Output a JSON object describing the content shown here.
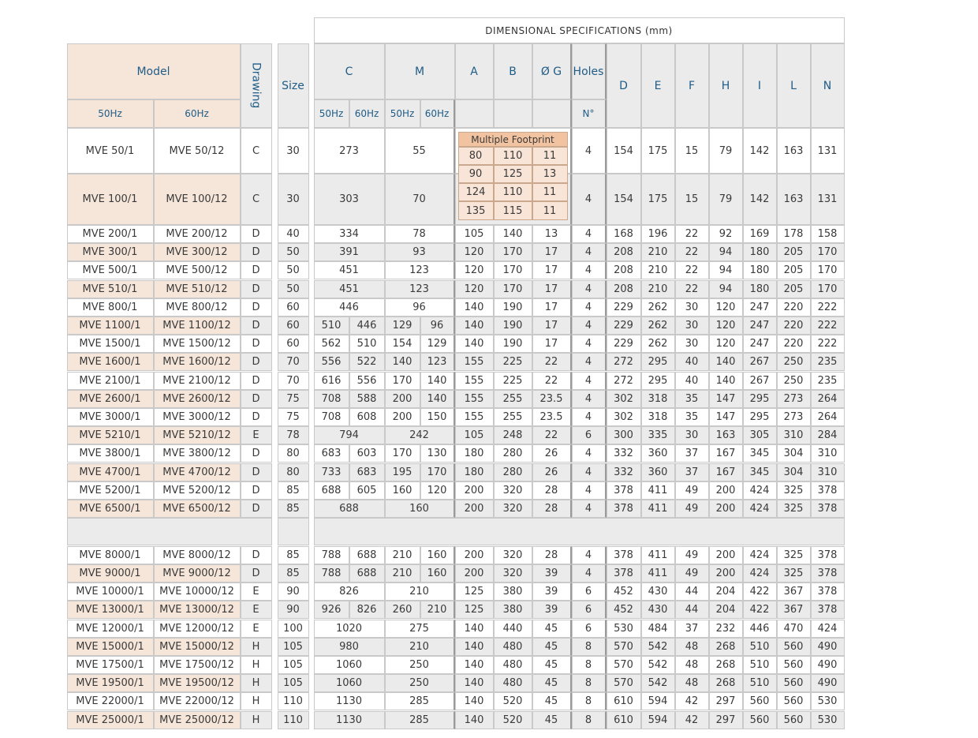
{
  "header": {
    "title": "DIMENSIONAL SPECIFICATIONS (mm)",
    "model": "Model",
    "hz50": "50Hz",
    "hz60": "60Hz",
    "drawing": "Drawing",
    "size": "Size",
    "C": "C",
    "M": "M",
    "A": "A",
    "B": "B",
    "G": "Ø G",
    "holes": "Holes",
    "no": "N°",
    "D": "D",
    "E": "E",
    "F": "F",
    "H": "H",
    "I": "I",
    "L": "L",
    "N": "N"
  },
  "footprint": {
    "title": "Multiple Footprint",
    "rows": [
      [
        "80",
        "110",
        "11"
      ],
      [
        "90",
        "125",
        "13"
      ],
      [
        "124",
        "110",
        "11"
      ],
      [
        "135",
        "115",
        "11"
      ]
    ]
  },
  "rows": [
    {
      "m50": "MVE 50/1",
      "m60": "MVE 50/12",
      "dr": "C",
      "size": "30",
      "c": [
        "273"
      ],
      "m": [
        "55"
      ],
      "abg": null,
      "holes": "4",
      "dims": [
        "154",
        "175",
        "15",
        "79",
        "142",
        "163",
        "131"
      ]
    },
    {
      "m50": "MVE 100/1",
      "m60": "MVE 100/12",
      "dr": "C",
      "size": "30",
      "c": [
        "303"
      ],
      "m": [
        "70"
      ],
      "abg": null,
      "holes": "4",
      "dims": [
        "154",
        "175",
        "15",
        "79",
        "142",
        "163",
        "131"
      ]
    },
    {
      "m50": "MVE 200/1",
      "m60": "MVE 200/12",
      "dr": "D",
      "size": "40",
      "c": [
        "334"
      ],
      "m": [
        "78"
      ],
      "abg": [
        "105",
        "140",
        "13"
      ],
      "holes": "4",
      "dims": [
        "168",
        "196",
        "22",
        "92",
        "169",
        "178",
        "158"
      ]
    },
    {
      "m50": "MVE 300/1",
      "m60": "MVE 300/12",
      "dr": "D",
      "size": "50",
      "c": [
        "391"
      ],
      "m": [
        "93"
      ],
      "abg": [
        "120",
        "170",
        "17"
      ],
      "holes": "4",
      "dims": [
        "208",
        "210",
        "22",
        "94",
        "180",
        "205",
        "170"
      ]
    },
    {
      "m50": "MVE 500/1",
      "m60": "MVE 500/12",
      "dr": "D",
      "size": "50",
      "c": [
        "451"
      ],
      "m": [
        "123"
      ],
      "abg": [
        "120",
        "170",
        "17"
      ],
      "holes": "4",
      "dims": [
        "208",
        "210",
        "22",
        "94",
        "180",
        "205",
        "170"
      ]
    },
    {
      "m50": "MVE 510/1",
      "m60": "MVE 510/12",
      "dr": "D",
      "size": "50",
      "c": [
        "451"
      ],
      "m": [
        "123"
      ],
      "abg": [
        "120",
        "170",
        "17"
      ],
      "holes": "4",
      "dims": [
        "208",
        "210",
        "22",
        "94",
        "180",
        "205",
        "170"
      ]
    },
    {
      "m50": "MVE 800/1",
      "m60": "MVE 800/12",
      "dr": "D",
      "size": "60",
      "c": [
        "446"
      ],
      "m": [
        "96"
      ],
      "abg": [
        "140",
        "190",
        "17"
      ],
      "holes": "4",
      "dims": [
        "229",
        "262",
        "30",
        "120",
        "247",
        "220",
        "222"
      ]
    },
    {
      "m50": "MVE 1100/1",
      "m60": "MVE 1100/12",
      "dr": "D",
      "size": "60",
      "c": [
        "510",
        "446"
      ],
      "m": [
        "129",
        "96"
      ],
      "abg": [
        "140",
        "190",
        "17"
      ],
      "holes": "4",
      "dims": [
        "229",
        "262",
        "30",
        "120",
        "247",
        "220",
        "222"
      ]
    },
    {
      "m50": "MVE 1500/1",
      "m60": "MVE 1500/12",
      "dr": "D",
      "size": "60",
      "c": [
        "562",
        "510"
      ],
      "m": [
        "154",
        "129"
      ],
      "abg": [
        "140",
        "190",
        "17"
      ],
      "holes": "4",
      "dims": [
        "229",
        "262",
        "30",
        "120",
        "247",
        "220",
        "222"
      ]
    },
    {
      "m50": "MVE 1600/1",
      "m60": "MVE 1600/12",
      "dr": "D",
      "size": "70",
      "c": [
        "556",
        "522"
      ],
      "m": [
        "140",
        "123"
      ],
      "abg": [
        "155",
        "225",
        "22"
      ],
      "holes": "4",
      "dims": [
        "272",
        "295",
        "40",
        "140",
        "267",
        "250",
        "235"
      ]
    },
    {
      "m50": "MVE 2100/1",
      "m60": "MVE 2100/12",
      "dr": "D",
      "size": "70",
      "c": [
        "616",
        "556"
      ],
      "m": [
        "170",
        "140"
      ],
      "abg": [
        "155",
        "225",
        "22"
      ],
      "holes": "4",
      "dims": [
        "272",
        "295",
        "40",
        "140",
        "267",
        "250",
        "235"
      ]
    },
    {
      "m50": "MVE 2600/1",
      "m60": "MVE 2600/12",
      "dr": "D",
      "size": "75",
      "c": [
        "708",
        "588"
      ],
      "m": [
        "200",
        "140"
      ],
      "abg": [
        "155",
        "255",
        "23.5"
      ],
      "holes": "4",
      "dims": [
        "302",
        "318",
        "35",
        "147",
        "295",
        "273",
        "264"
      ]
    },
    {
      "m50": "MVE 3000/1",
      "m60": "MVE 3000/12",
      "dr": "D",
      "size": "75",
      "c": [
        "708",
        "608"
      ],
      "m": [
        "200",
        "150"
      ],
      "abg": [
        "155",
        "255",
        "23.5"
      ],
      "holes": "4",
      "dims": [
        "302",
        "318",
        "35",
        "147",
        "295",
        "273",
        "264"
      ]
    },
    {
      "m50": "MVE 5210/1",
      "m60": "MVE 5210/12",
      "dr": "E",
      "size": "78",
      "c": [
        "794"
      ],
      "m": [
        "242"
      ],
      "abg": [
        "105",
        "248",
        "22"
      ],
      "holes": "6",
      "dims": [
        "300",
        "335",
        "30",
        "163",
        "305",
        "310",
        "284"
      ]
    },
    {
      "m50": "MVE 3800/1",
      "m60": "MVE 3800/12",
      "dr": "D",
      "size": "80",
      "c": [
        "683",
        "603"
      ],
      "m": [
        "170",
        "130"
      ],
      "abg": [
        "180",
        "280",
        "26"
      ],
      "holes": "4",
      "dims": [
        "332",
        "360",
        "37",
        "167",
        "345",
        "304",
        "310"
      ]
    },
    {
      "m50": "MVE 4700/1",
      "m60": "MVE 4700/12",
      "dr": "D",
      "size": "80",
      "c": [
        "733",
        "683"
      ],
      "m": [
        "195",
        "170"
      ],
      "abg": [
        "180",
        "280",
        "26"
      ],
      "holes": "4",
      "dims": [
        "332",
        "360",
        "37",
        "167",
        "345",
        "304",
        "310"
      ]
    },
    {
      "m50": "MVE 5200/1",
      "m60": "MVE 5200/12",
      "dr": "D",
      "size": "85",
      "c": [
        "688",
        "605"
      ],
      "m": [
        "160",
        "120"
      ],
      "abg": [
        "200",
        "320",
        "28"
      ],
      "holes": "4",
      "dims": [
        "378",
        "411",
        "49",
        "200",
        "424",
        "325",
        "378"
      ]
    },
    {
      "m50": "MVE 6500/1",
      "m60": "MVE 6500/12",
      "dr": "D",
      "size": "85",
      "c": [
        "688"
      ],
      "m": [
        "160"
      ],
      "abg": [
        "200",
        "320",
        "28"
      ],
      "holes": "4",
      "dims": [
        "378",
        "411",
        "49",
        "200",
        "424",
        "325",
        "378"
      ]
    },
    {
      "m50": "MVE 8000/1",
      "m60": "MVE 8000/12",
      "dr": "D",
      "size": "85",
      "c": [
        "788",
        "688"
      ],
      "m": [
        "210",
        "160"
      ],
      "abg": [
        "200",
        "320",
        "28"
      ],
      "holes": "4",
      "dims": [
        "378",
        "411",
        "49",
        "200",
        "424",
        "325",
        "378"
      ]
    },
    {
      "m50": "MVE 9000/1",
      "m60": "MVE 9000/12",
      "dr": "D",
      "size": "85",
      "c": [
        "788",
        "688"
      ],
      "m": [
        "210",
        "160"
      ],
      "abg": [
        "200",
        "320",
        "39"
      ],
      "holes": "4",
      "dims": [
        "378",
        "411",
        "49",
        "200",
        "424",
        "325",
        "378"
      ]
    },
    {
      "m50": "MVE 10000/1",
      "m60": "MVE 10000/12",
      "dr": "E",
      "size": "90",
      "c": [
        "826"
      ],
      "m": [
        "210"
      ],
      "abg": [
        "125",
        "380",
        "39"
      ],
      "holes": "6",
      "dims": [
        "452",
        "430",
        "44",
        "204",
        "422",
        "367",
        "378"
      ]
    },
    {
      "m50": "MVE 13000/1",
      "m60": "MVE 13000/12",
      "dr": "E",
      "size": "90",
      "c": [
        "926",
        "826"
      ],
      "m": [
        "260",
        "210"
      ],
      "abg": [
        "125",
        "380",
        "39"
      ],
      "holes": "6",
      "dims": [
        "452",
        "430",
        "44",
        "204",
        "422",
        "367",
        "378"
      ]
    },
    {
      "m50": "MVE 12000/1",
      "m60": "MVE 12000/12",
      "dr": "E",
      "size": "100",
      "c": [
        "1020"
      ],
      "m": [
        "275"
      ],
      "abg": [
        "140",
        "440",
        "45"
      ],
      "holes": "6",
      "dims": [
        "530",
        "484",
        "37",
        "232",
        "446",
        "470",
        "424"
      ]
    },
    {
      "m50": "MVE 15000/1",
      "m60": "MVE 15000/12",
      "dr": "H",
      "size": "105",
      "c": [
        "980"
      ],
      "m": [
        "210"
      ],
      "abg": [
        "140",
        "480",
        "45"
      ],
      "holes": "8",
      "dims": [
        "570",
        "542",
        "48",
        "268",
        "510",
        "560",
        "490"
      ]
    },
    {
      "m50": "MVE 17500/1",
      "m60": "MVE 17500/12",
      "dr": "H",
      "size": "105",
      "c": [
        "1060"
      ],
      "m": [
        "250"
      ],
      "abg": [
        "140",
        "480",
        "45"
      ],
      "holes": "8",
      "dims": [
        "570",
        "542",
        "48",
        "268",
        "510",
        "560",
        "490"
      ]
    },
    {
      "m50": "MVE 19500/1",
      "m60": "MVE 19500/12",
      "dr": "H",
      "size": "105",
      "c": [
        "1060"
      ],
      "m": [
        "250"
      ],
      "abg": [
        "140",
        "480",
        "45"
      ],
      "holes": "8",
      "dims": [
        "570",
        "542",
        "48",
        "268",
        "510",
        "560",
        "490"
      ]
    },
    {
      "m50": "MVE 22000/1",
      "m60": "MVE 22000/12",
      "dr": "H",
      "size": "110",
      "c": [
        "1130"
      ],
      "m": [
        "285"
      ],
      "abg": [
        "140",
        "520",
        "45"
      ],
      "holes": "8",
      "dims": [
        "610",
        "594",
        "42",
        "297",
        "560",
        "560",
        "530"
      ]
    },
    {
      "m50": "MVE 25000/1",
      "m60": "MVE 25000/12",
      "dr": "H",
      "size": "110",
      "c": [
        "1130"
      ],
      "m": [
        "285"
      ],
      "abg": [
        "140",
        "520",
        "45"
      ],
      "holes": "8",
      "dims": [
        "610",
        "594",
        "42",
        "297",
        "560",
        "560",
        "530"
      ]
    }
  ],
  "colors": {
    "peach": "#f6e6da",
    "gray": "#ebebeb",
    "white": "#ffffff",
    "header_text": "#1f5c86",
    "footprint_title": "#f2c3a0",
    "footprint_cell": "#f8e5d7",
    "grid": "#c9c9c9",
    "grid_dark": "#9a9a9a"
  }
}
